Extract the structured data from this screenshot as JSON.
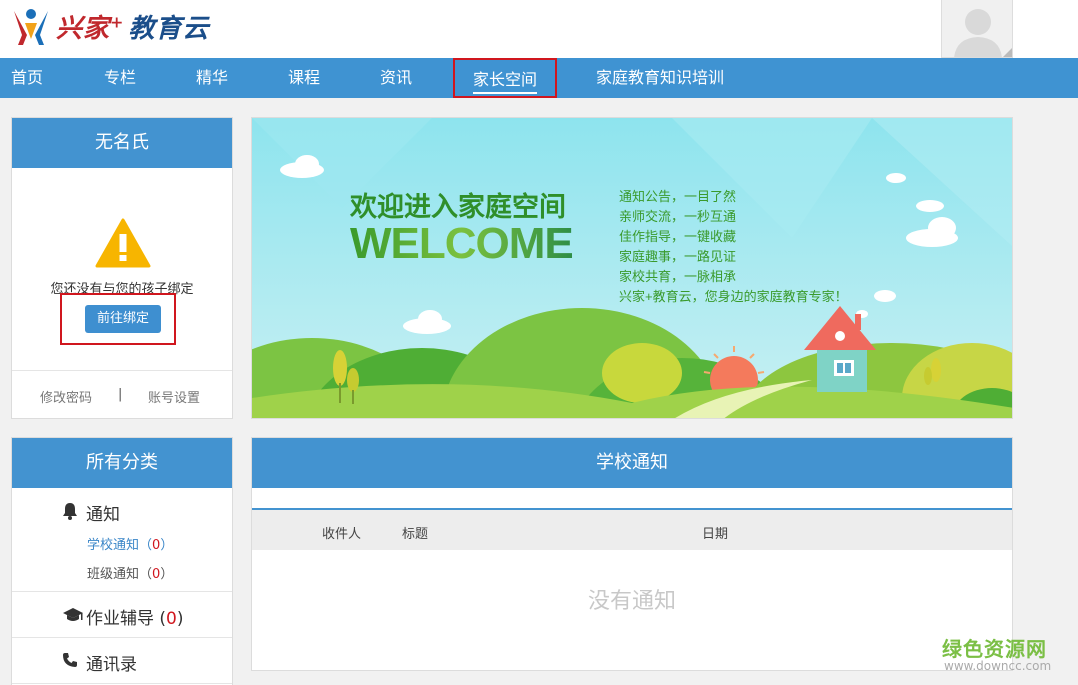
{
  "header": {
    "logo_main": "兴家",
    "logo_plus": "+",
    "logo_sub": "教育云"
  },
  "nav": {
    "items": [
      "首页",
      "专栏",
      "精华",
      "课程",
      "资讯",
      "家长空间",
      "家庭教育知识培训"
    ],
    "active": "家长空间"
  },
  "profile": {
    "name": "无名氏",
    "notice": "您还没有与您的孩子绑定",
    "bind_button": "前往绑定",
    "change_password": "修改密码",
    "separator": "|",
    "account_settings": "账号设置"
  },
  "categories": {
    "title": "所有分类",
    "notice": {
      "label": "通知",
      "school_label": "学校通知",
      "school_count": "0",
      "class_label": "班级通知",
      "class_count": "0"
    },
    "homework": {
      "label": "作业辅导",
      "count": "0"
    },
    "contacts": {
      "label": "通讯录"
    }
  },
  "banner": {
    "heading": "欢迎进入家庭空间",
    "welcome": "WELCOME",
    "lines": [
      "通知公告，一目了然",
      "亲师交流，一秒互通",
      "佳作指导，一键收藏",
      "家庭趣事，一路见证",
      "家校共育，一脉相承",
      "兴家+教育云，您身边的家庭教育专家！"
    ]
  },
  "school_notice": {
    "title": "学校通知",
    "columns": [
      "收件人",
      "标题",
      "日期"
    ],
    "empty_text": "没有通知"
  },
  "watermark": {
    "name": "绿色资源网",
    "url": "www.downcc.com"
  },
  "colors": {
    "nav_blue": "#3f93d2",
    "panel_head_blue": "#4393d0",
    "highlight_red": "#d0161e",
    "count_red": "#d0161e",
    "link_blue": "#3a86c8"
  }
}
